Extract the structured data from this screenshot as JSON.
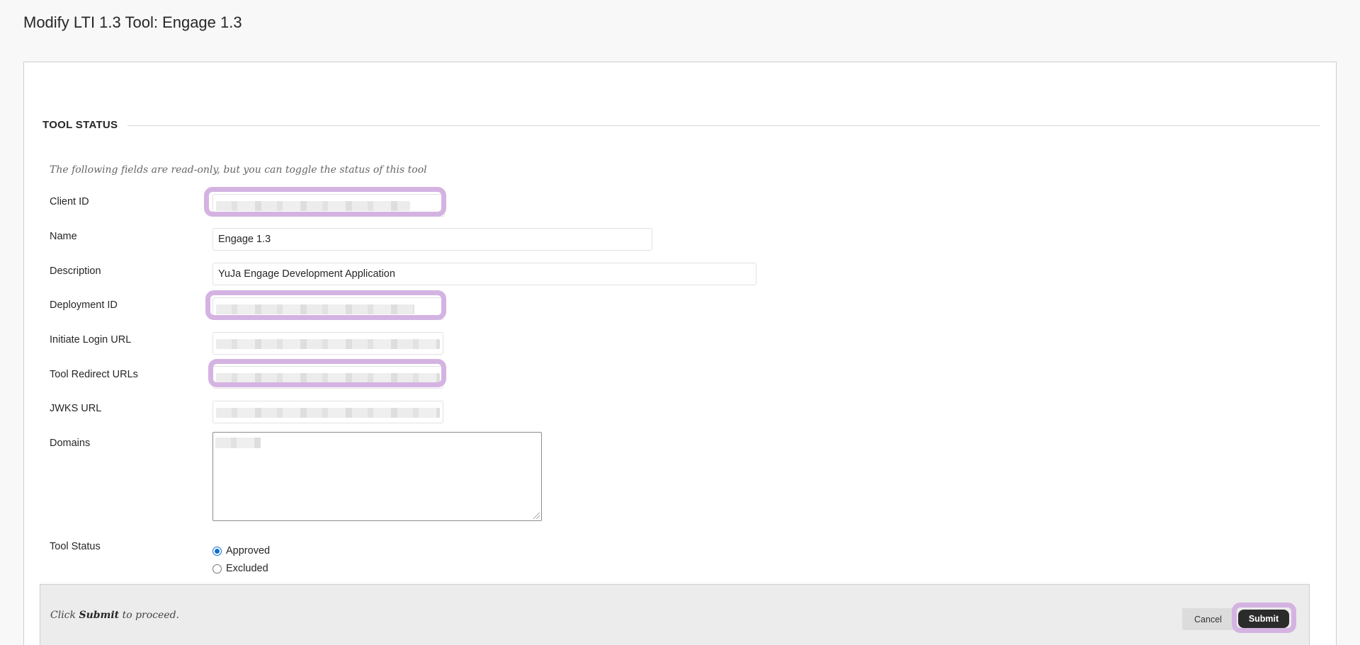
{
  "page": {
    "title": "Modify LTI 1.3 Tool: Engage 1.3"
  },
  "section": {
    "title": "TOOL STATUS",
    "instructions": "The following fields are read-only, but you can toggle the status of this tool"
  },
  "fields": {
    "client_id": {
      "label": "Client ID"
    },
    "name": {
      "label": "Name",
      "value": "Engage 1.3"
    },
    "description": {
      "label": "Description",
      "value": "YuJa Engage Development Application"
    },
    "deployment_id": {
      "label": "Deployment ID"
    },
    "initiate_login_url": {
      "label": "Initiate Login URL"
    },
    "tool_redirect_urls": {
      "label": "Tool Redirect URLs"
    },
    "jwks_url": {
      "label": "JWKS URL"
    },
    "domains": {
      "label": "Domains"
    }
  },
  "tool_status": {
    "label": "Tool Status",
    "options": [
      {
        "label": "Approved",
        "selected": true
      },
      {
        "label": "Excluded",
        "selected": false
      }
    ]
  },
  "submit_bar": {
    "hint_prefix": "Click",
    "hint_bold": "Submit",
    "hint_suffix": "to proceed.",
    "cancel_label": "Cancel",
    "submit_label": "Submit"
  },
  "colors": {
    "highlight": "#d4b3e2",
    "radio_selected": "#0f6fd1",
    "submit_button": "#2b2b2b"
  }
}
